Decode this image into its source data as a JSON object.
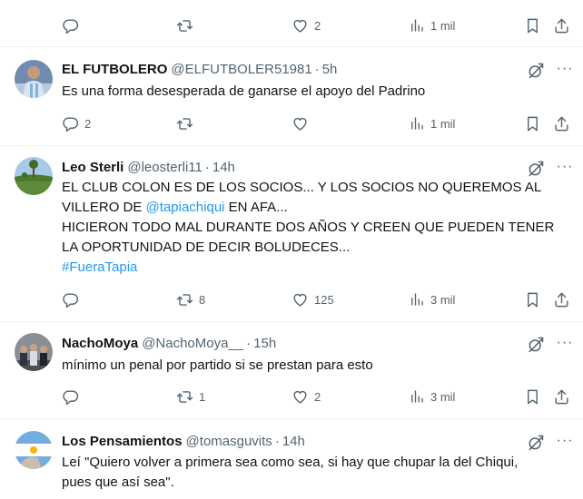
{
  "top_actions": {
    "reply": "",
    "retweet": "",
    "like": "2",
    "views": "1 mil"
  },
  "tweets": [
    {
      "name": "EL FUTBOLERO",
      "handle": "@ELFUTBOLER51981",
      "dot": "·",
      "time": "5h",
      "lines": [
        "Es una forma desesperada de ganarse el apoyo del Padrino"
      ],
      "reply": "2",
      "retweet": "",
      "like": "",
      "views": "1 mil"
    },
    {
      "name": "Leo Sterli",
      "handle": "@leosterli11",
      "dot": "·",
      "time": "14h",
      "line1": "EL CLUB COLON ES DE LOS SOCIOS... Y LOS SOCIOS NO QUEREMOS AL",
      "line2_pre": "VILLERO DE ",
      "line2_mention": "@tapiachiqui",
      "line2_post": " EN AFA...",
      "line3": "HICIERON TODO MAL DURANTE DOS AÑOS Y CREEN QUE PUEDEN TENER",
      "line4": "LA OPORTUNIDAD DE DECIR BOLUDECES...",
      "hashtag": "#FueraTapia",
      "reply": "",
      "retweet": "8",
      "like": "125",
      "views": "3 mil"
    },
    {
      "name": "NachoMoya",
      "handle": "@NachoMoya__",
      "dot": "·",
      "time": "15h",
      "lines": [
        "mínimo un penal por partido si se prestan para esto"
      ],
      "reply": "",
      "retweet": "1",
      "like": "2",
      "views": "3 mil"
    },
    {
      "name": "Los Pensamientos",
      "handle": "@tomasguvits",
      "dot": "·",
      "time": "14h",
      "lines": [
        "Leí \"Quiero volver a primera sea como sea, si hay que chupar la del Chiqui,",
        "pues que así sea\"."
      ]
    }
  ],
  "icons": [
    "reply-icon",
    "retweet-icon",
    "like-icon",
    "views-icon",
    "bookmark-icon",
    "share-icon",
    "grok-icon",
    "more-icon"
  ],
  "colors": {
    "text": "#0f1419",
    "secondary": "#536471",
    "link": "#1d9bf0",
    "divider": "#eff3f4"
  }
}
